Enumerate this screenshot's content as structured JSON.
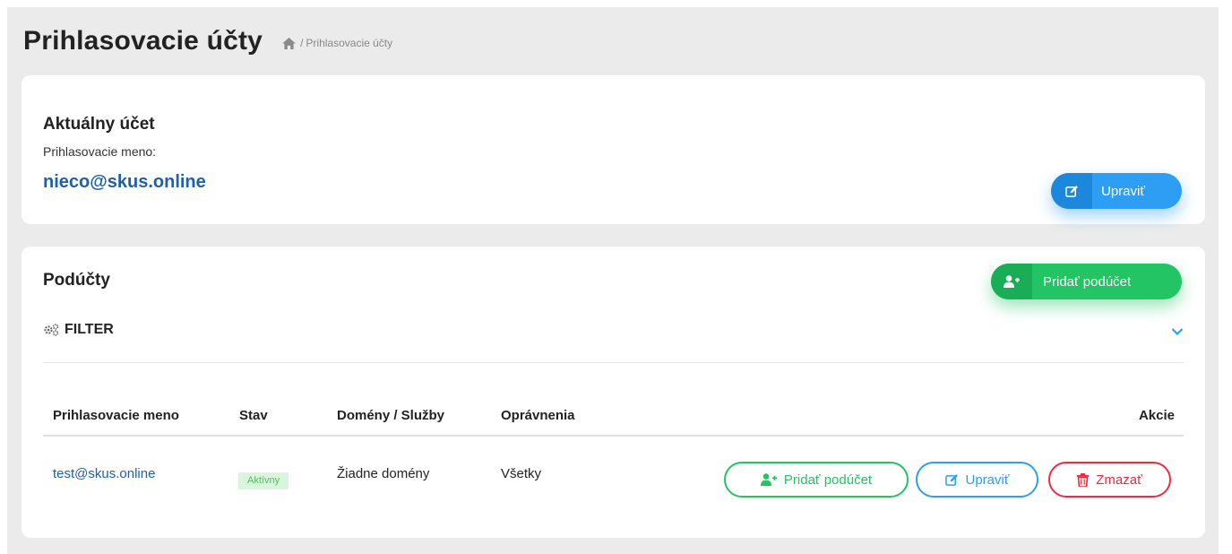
{
  "page": {
    "title": "Prihlasovacie účty",
    "breadcrumb": {
      "separator": "/",
      "current": "Prihlasovacie účty"
    }
  },
  "current_account": {
    "heading": "Aktuálny účet",
    "label": "Prihlasovacie meno:",
    "email": "nieco@skus.online",
    "edit_label": "Upraviť"
  },
  "subaccounts": {
    "heading": "Podúčty",
    "add_label": "Pridať podúčet",
    "filter_label": "FILTER",
    "columns": [
      "Prihlasovacie meno",
      "Stav",
      "Domény / Služby",
      "Oprávnenia",
      "Akcie"
    ],
    "rows": [
      {
        "login": "test@skus.online",
        "status": "Aktívny",
        "domains": "Žiadne domény",
        "permissions": "Všetky",
        "actions": {
          "add": "Pridať podúčet",
          "edit": "Upraviť",
          "delete": "Zmazať"
        }
      }
    ]
  },
  "icons": {
    "breadcrumb_home": "home-icon",
    "edit": "edit-icon",
    "add_user": "user-plus-icon",
    "filter": "cogs-icon",
    "expand": "chevron-down-icon",
    "delete": "trash-icon"
  },
  "colors": {
    "primary_blue": "#2d9ef3",
    "success_green": "#22c464",
    "danger_red": "#ef2b43",
    "link_blue": "#1e5fb0",
    "badge_bg": "#d9f5dc",
    "badge_text": "#56b968"
  }
}
